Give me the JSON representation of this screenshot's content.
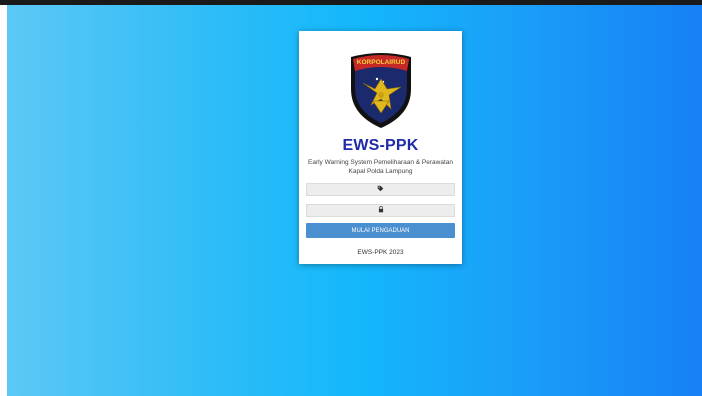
{
  "login": {
    "logo_text": "KORPOLAIRUD",
    "logo_icon": "korpolairud-shield-emblem",
    "title": "EWS-PPK",
    "subtitle": "Early Warning System Pemeliharaan & Perawatan Kapal Polda Lampung",
    "username_icon": "tag-icon",
    "username_value": "",
    "password_icon": "lock-icon",
    "password_value": "",
    "submit_label": "MULAI PENGADUAN",
    "footer": "EWS-PPK 2023"
  },
  "colors": {
    "background_left": "#5cc8f5",
    "background_right": "#1680f5",
    "title": "#1f2ba8",
    "button": "#4a8fd0",
    "shield_body": "#1a2a6c",
    "shield_red": "#c62828",
    "eagle_gold": "#e0b81e"
  }
}
